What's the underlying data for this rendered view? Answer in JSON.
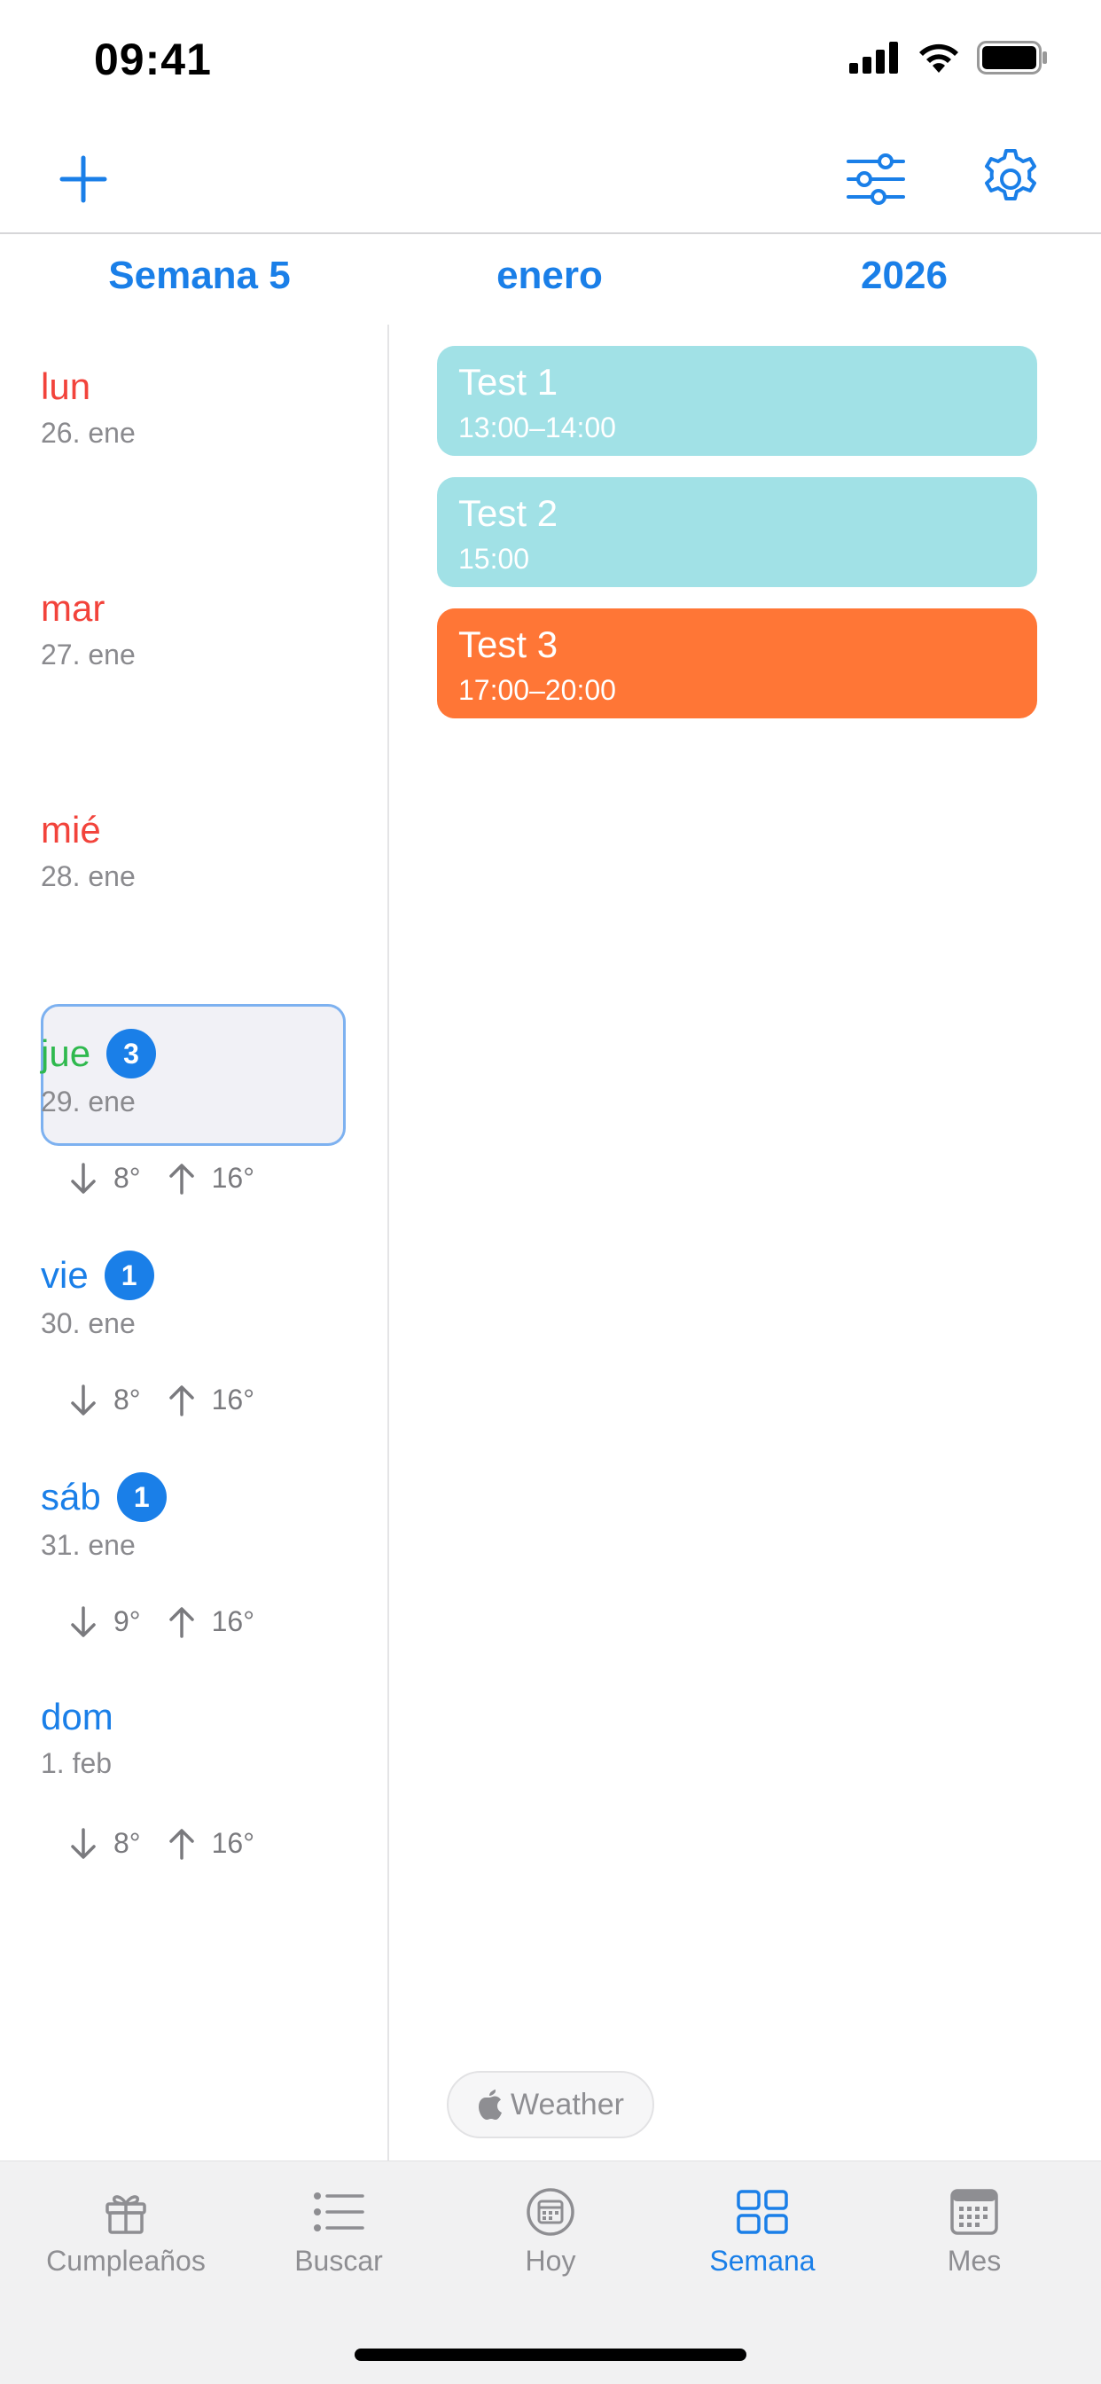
{
  "status_bar": {
    "time": "09:41"
  },
  "header": {
    "week": "Semana 5",
    "month": "enero",
    "year": "2026"
  },
  "days": [
    {
      "name": "lun",
      "date": "26. ene",
      "color": "#f2433b"
    },
    {
      "name": "mar",
      "date": "27. ene",
      "color": "#f2433b"
    },
    {
      "name": "mié",
      "date": "28. ene",
      "color": "#f2433b"
    },
    {
      "name": "jue",
      "date": "29. ene",
      "badge": "3",
      "selected": true,
      "color": "#2fb94e",
      "low": "8°",
      "high": "16°"
    },
    {
      "name": "vie",
      "date": "30. ene",
      "badge": "1",
      "color": "#1a7fe8",
      "low": "8°",
      "high": "16°"
    },
    {
      "name": "sáb",
      "date": "31. ene",
      "badge": "1",
      "color": "#1a7fe8",
      "low": "9°",
      "high": "16°"
    },
    {
      "name": "dom",
      "date": "1. feb",
      "color": "#1a7fe8",
      "low": "8°",
      "high": "16°"
    }
  ],
  "events": [
    {
      "title": "Test 1",
      "time": "13:00–14:00",
      "color": "#a1e1e6"
    },
    {
      "title": "Test 2",
      "time": "15:00",
      "color": "#a1e1e6"
    },
    {
      "title": "Test 3",
      "time": "17:00–20:00",
      "color": "#ff7636"
    }
  ],
  "weather_attribution": "Weather",
  "tabs": [
    {
      "label": "Cumpleaños",
      "icon": "gift-icon"
    },
    {
      "label": "Buscar",
      "icon": "list-icon"
    },
    {
      "label": "Hoy",
      "icon": "today-icon"
    },
    {
      "label": "Semana",
      "icon": "week-grid-icon",
      "active": true
    },
    {
      "label": "Mes",
      "icon": "month-calendar-icon"
    }
  ],
  "colors": {
    "accent": "#1a7fe8",
    "weekday_past": "#f2433b",
    "today": "#2fb94e"
  }
}
